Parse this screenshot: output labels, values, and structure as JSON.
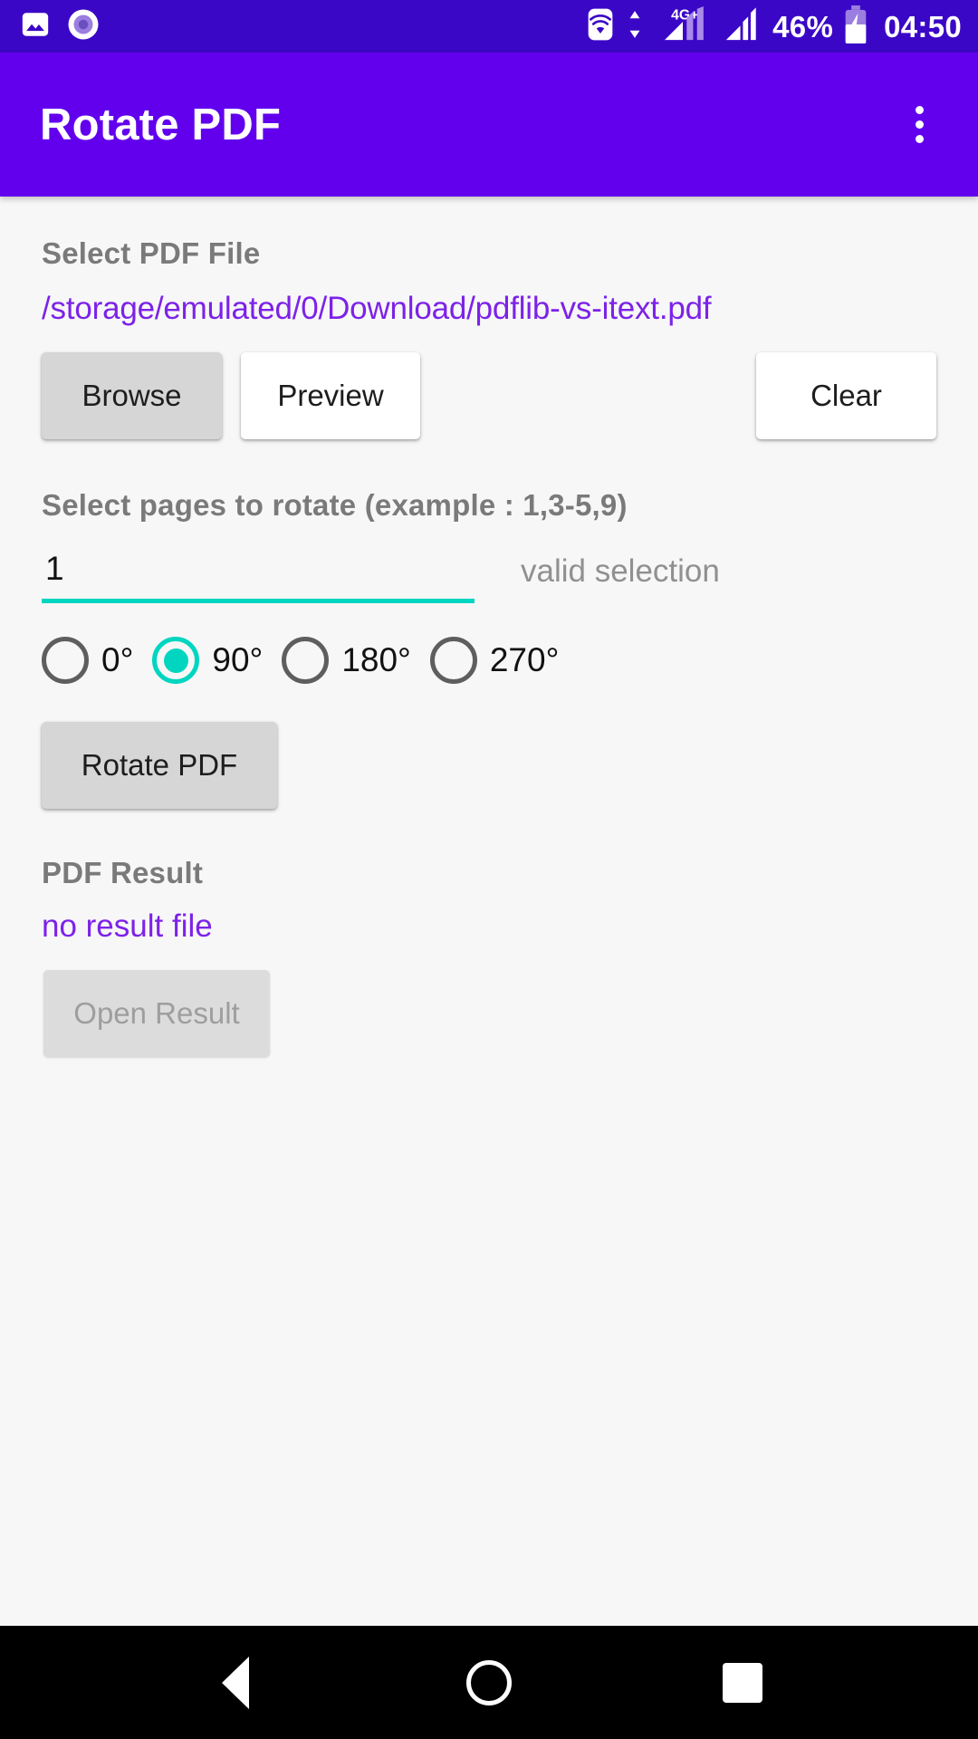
{
  "status_bar": {
    "icons_left": [
      "image-icon",
      "record-circle-icon"
    ],
    "icons_right": [
      "wifi-icon",
      "data-transfer-icon",
      "signal-4gplus-icon",
      "signal-bars-icon"
    ],
    "network_label": "4G+",
    "battery_percent": "46%",
    "battery_icon": "battery-charging-icon",
    "clock": "04:50",
    "background_color": "#3b07c6"
  },
  "app_bar": {
    "title": "Rotate PDF",
    "overflow_icon": "more-vertical-icon",
    "background_color": "#6200ee"
  },
  "main": {
    "file_section": {
      "label": "Select PDF File",
      "path": "/storage/emulated/0/Download/pdflib-vs-itext.pdf",
      "path_color": "#7c22e8",
      "buttons": [
        {
          "name": "browse",
          "label": "Browse",
          "style": "gray",
          "enabled": true
        },
        {
          "name": "preview",
          "label": "Preview",
          "style": "white",
          "enabled": true
        },
        {
          "name": "clear",
          "label": "Clear",
          "style": "white",
          "enabled": true
        }
      ]
    },
    "pages_section": {
      "label": "Select pages to rotate (example : 1,3-5,9)",
      "input_value": "1",
      "input_placeholder": "",
      "validation_text": "valid selection",
      "underline_color": "#00d5c0"
    },
    "rotation_options": {
      "selected_value": "90°",
      "accent_color": "#00d5c0",
      "options": [
        {
          "value": "0°",
          "selected": false
        },
        {
          "value": "90°",
          "selected": true
        },
        {
          "value": "180°",
          "selected": false
        },
        {
          "value": "270°",
          "selected": false
        }
      ]
    },
    "rotate_action": {
      "label": "Rotate PDF",
      "style": "gray",
      "enabled": true
    },
    "result_section": {
      "label": "PDF Result",
      "result_text": "no result file",
      "result_color": "#7c22e8",
      "open_button_label": "Open Result",
      "open_button_enabled": false
    }
  },
  "nav_bar": {
    "buttons": [
      {
        "name": "back",
        "icon": "triangle-back-icon"
      },
      {
        "name": "home",
        "icon": "circle-home-icon"
      },
      {
        "name": "recents",
        "icon": "square-recents-icon"
      }
    ],
    "background_color": "#000000"
  }
}
